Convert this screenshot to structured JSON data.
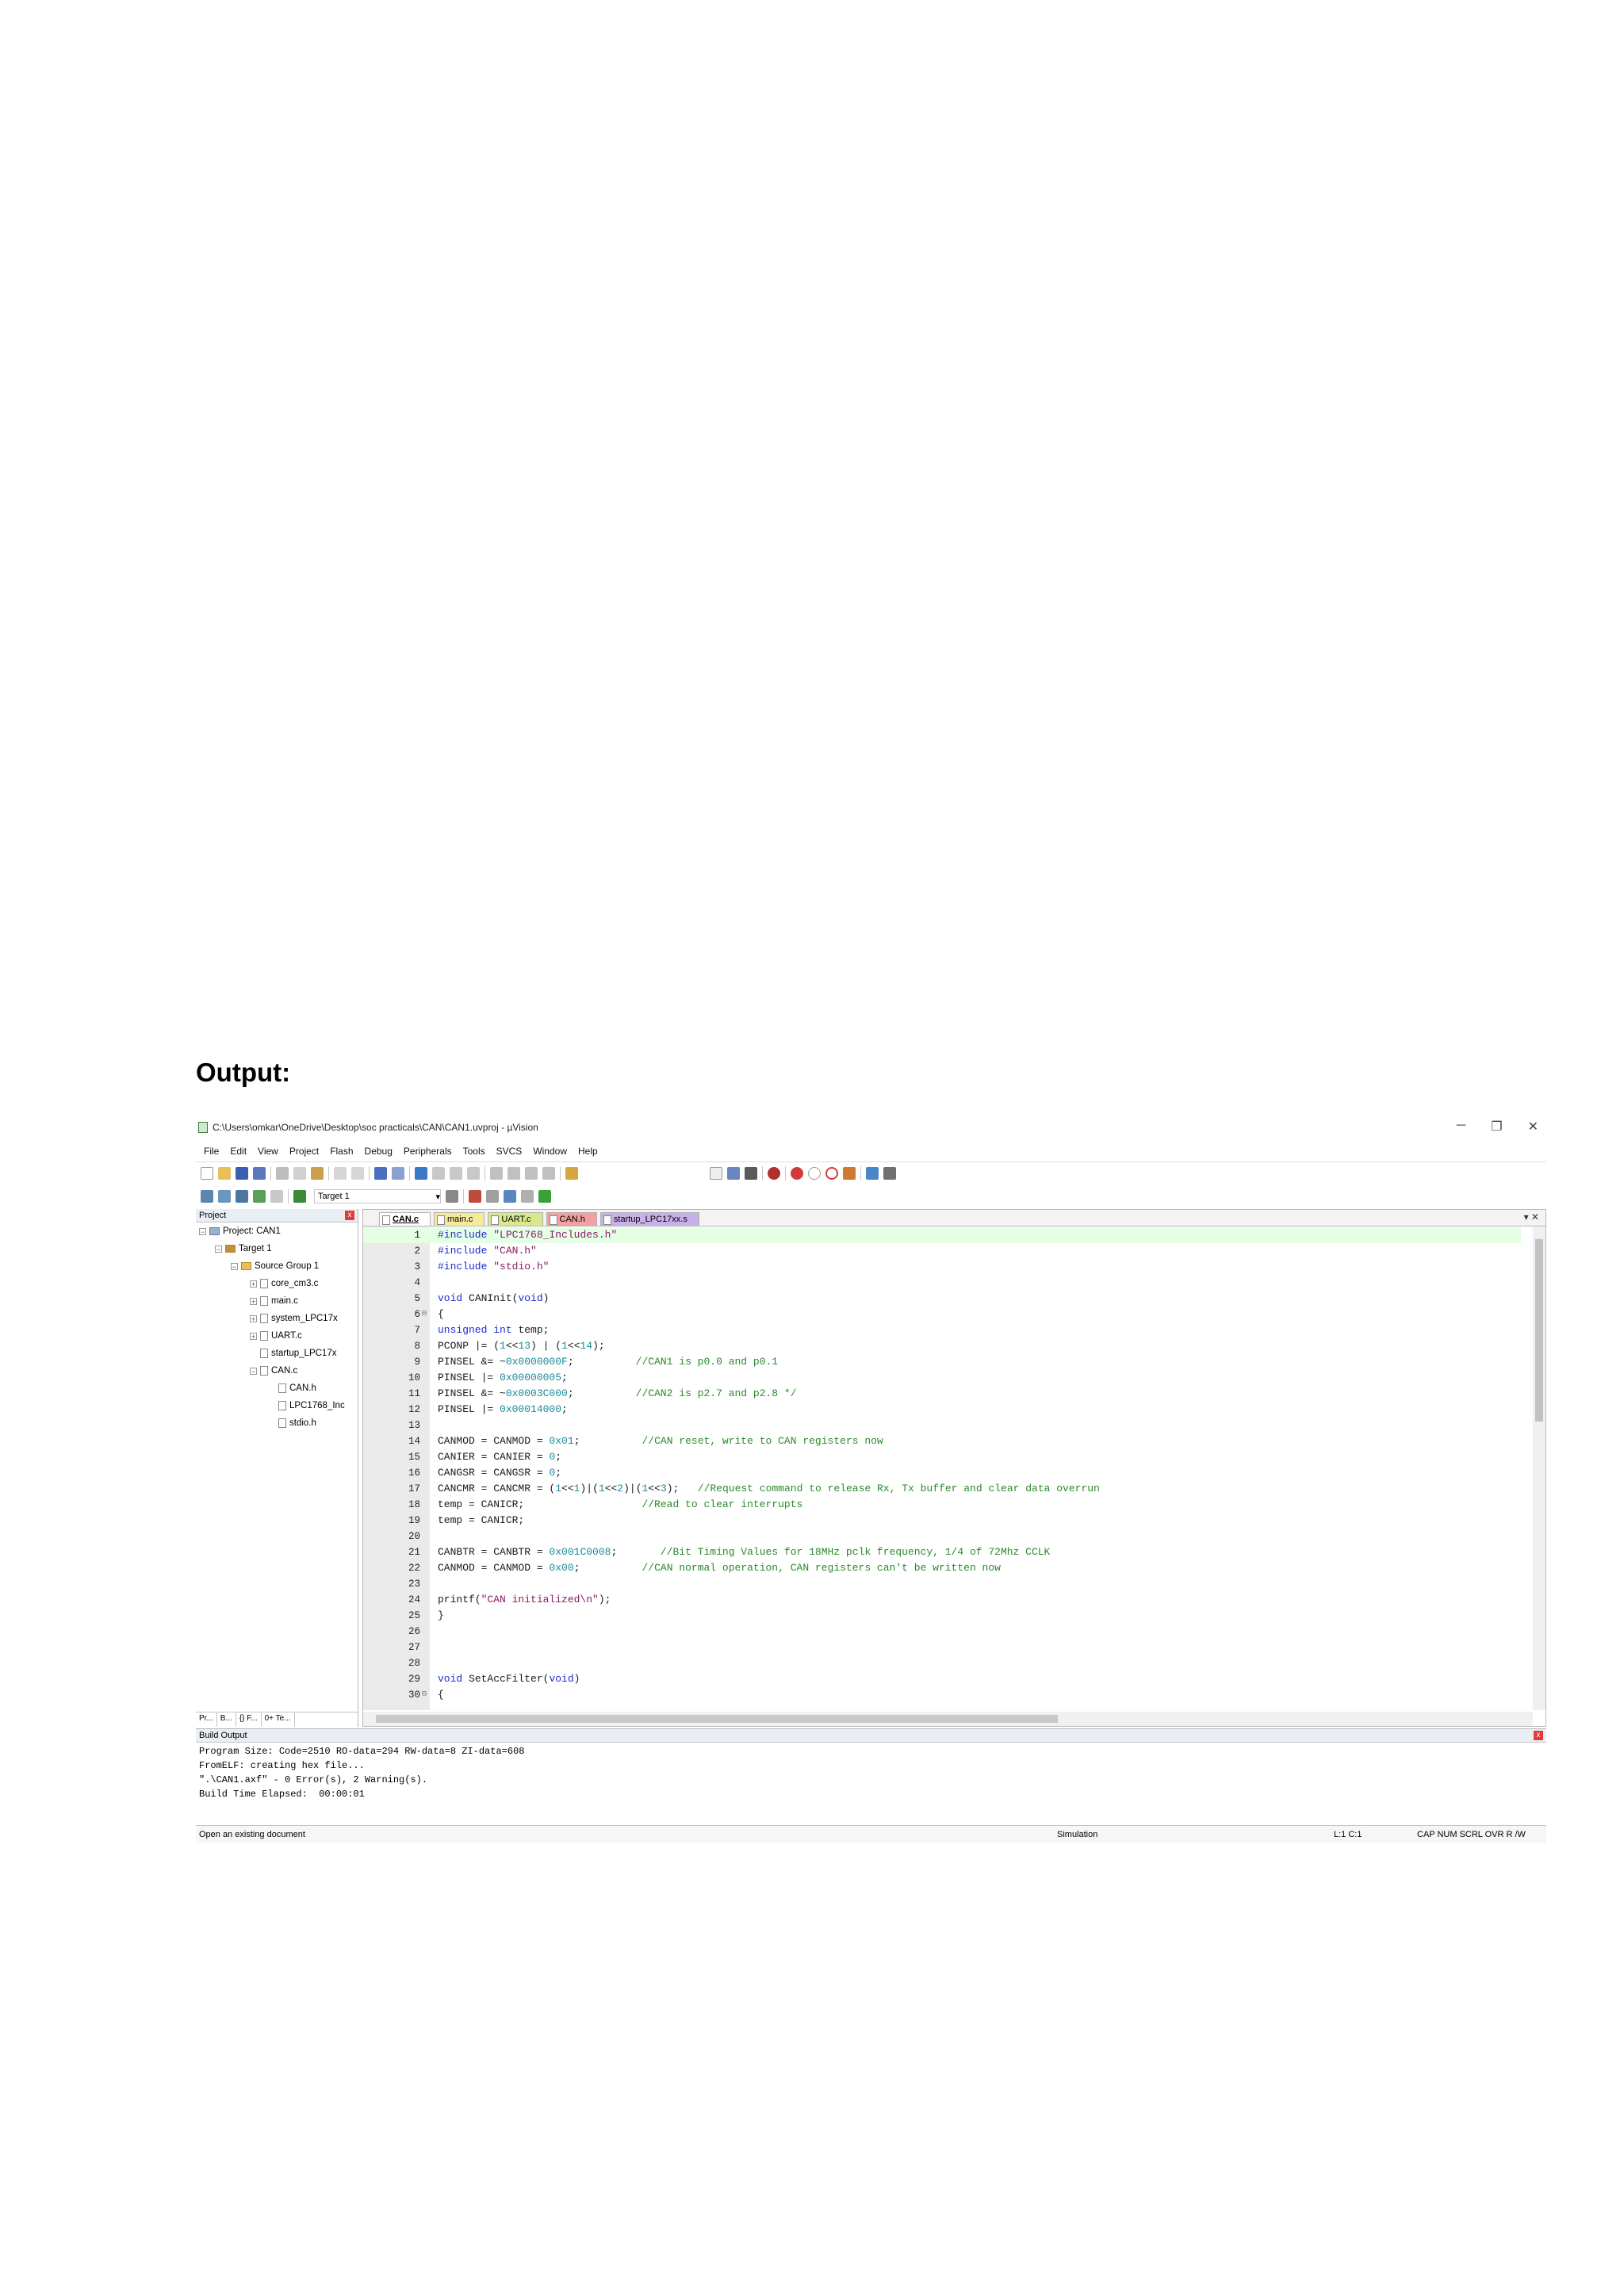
{
  "page_heading": "Output:",
  "window": {
    "title": "C:\\Users\\omkar\\OneDrive\\Desktop\\soc practicals\\CAN\\CAN1.uvproj - µVision",
    "minimize": "─",
    "restore": "❐",
    "close": "✕"
  },
  "menu": [
    "File",
    "Edit",
    "View",
    "Project",
    "Flash",
    "Debug",
    "Peripherals",
    "Tools",
    "SVCS",
    "Window",
    "Help"
  ],
  "toolbar": {
    "target": "Target 1"
  },
  "project_panel": {
    "title": "Project",
    "close": "x",
    "tree": {
      "project": "Project: CAN1",
      "target": "Target 1",
      "group": "Source Group 1",
      "files": [
        "core_cm3.c",
        "main.c",
        "system_LPC17x",
        "UART.c",
        "startup_LPC17x",
        "CAN.c"
      ],
      "includes": [
        "CAN.h",
        "LPC1768_Inc",
        "stdio.h"
      ]
    },
    "bottom_tabs": [
      "Pr...",
      "B...",
      "{} F...",
      "0+ Te..."
    ]
  },
  "editor": {
    "tabs": [
      "CAN.c",
      "main.c",
      "UART.c",
      "CAN.h",
      "startup_LPC17xx.s"
    ],
    "active_tab": "CAN.c",
    "tab_controls": "▾ ✕",
    "lines": [
      "#include \"LPC1768_Includes.h\"",
      "#include \"CAN.h\"",
      "#include \"stdio.h\"",
      "",
      "void CANInit(void)",
      "{",
      "unsigned int temp;",
      "PCONP |= (1<<13) | (1<<14);",
      "PINSEL0 &= ~0x0000000F;          //CAN1 is p0.0 and p0.1",
      "PINSEL0 |= 0x00000005;",
      "PINSEL4 &= ~0x0003C000;          //CAN2 is p2.7 and p2.8 */",
      "PINSEL4 |= 0x00014000;",
      "",
      "CAN1MOD = CAN2MOD = 0x01;          //CAN reset, write to CAN registers now",
      "CAN1IER = CAN2IER = 0;",
      "CAN1GSR = CAN2GSR = 0;",
      "CAN1CMR = CAN2CMR = (1<<1)|(1<<2)|(1<<3);   //Request command to release Rx, Tx buffer and clear data overrun",
      "temp = CAN1ICR;                   //Read to clear interrupts",
      "temp = CAN2ICR;",
      "",
      "CAN1BTR = CAN2BTR = 0x001C0008;       //Bit Timing Values for 18MHz pclk frequency, 1/4 of 72Mhz CCLK",
      "CAN1MOD = CAN2MOD = 0x00;          //CAN normal operation, CAN registers can't be written now",
      "",
      "printf(\"CAN initialized\\n\");",
      "}",
      "",
      "",
      "",
      "void SetAccFilter(void)",
      "{"
    ]
  },
  "build_output": {
    "title": "Build Output",
    "lines": [
      "Program Size: Code=2510 RO-data=294 RW-data=8 ZI-data=608",
      "FromELF: creating hex file...",
      "\".\\CAN1.axf\" - 0 Error(s), 2 Warning(s).",
      "Build Time Elapsed:  00:00:01"
    ]
  },
  "status": {
    "message": "Open an existing document",
    "mode": "Simulation",
    "position": "L:1 C:1",
    "indicators": "CAP  NUM  SCRL  OVR  R /W"
  }
}
